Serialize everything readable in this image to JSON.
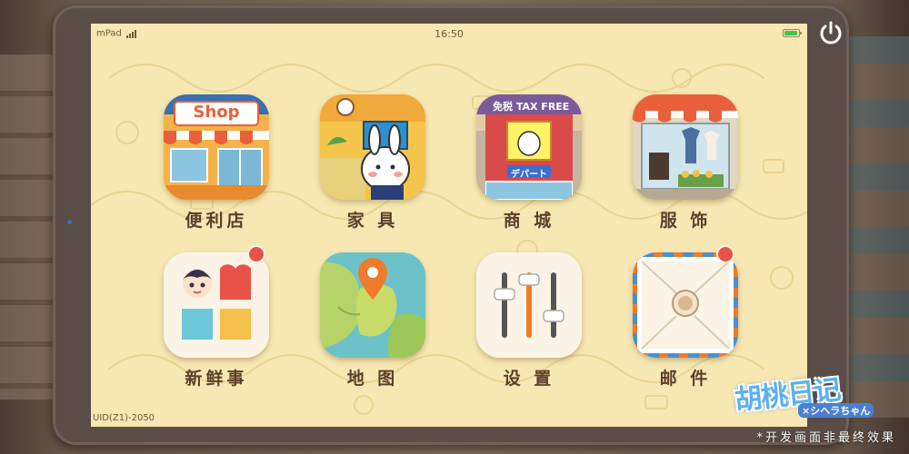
{
  "statusbar": {
    "carrier": "mPad",
    "time": "16:50",
    "battery_level": 0.9
  },
  "apps": [
    {
      "label": "便利店",
      "sign_text": "Shop",
      "badge": false
    },
    {
      "label": "家 具",
      "badge": false
    },
    {
      "label": "商 城",
      "sign_text": "免税 TAX FREE",
      "banner_text": "デパート",
      "badge": false
    },
    {
      "label": "服 饰",
      "badge": false
    },
    {
      "label": "新鲜事",
      "badge": true
    },
    {
      "label": "地 图",
      "badge": false
    },
    {
      "label": "设 置",
      "badge": false
    },
    {
      "label": "邮 件",
      "badge": true
    }
  ],
  "footer": {
    "uid": "UID(Z1)-2050",
    "logo_title": "胡桃日记",
    "logo_subtitle": "×シヘラちゃん",
    "disclaimer": "*开发画面非最终效果"
  },
  "colors": {
    "screen_bg": "#f6e7b3",
    "label": "#5b3f2a",
    "badge": "#e8524a",
    "accent_orange": "#f07b2a"
  }
}
